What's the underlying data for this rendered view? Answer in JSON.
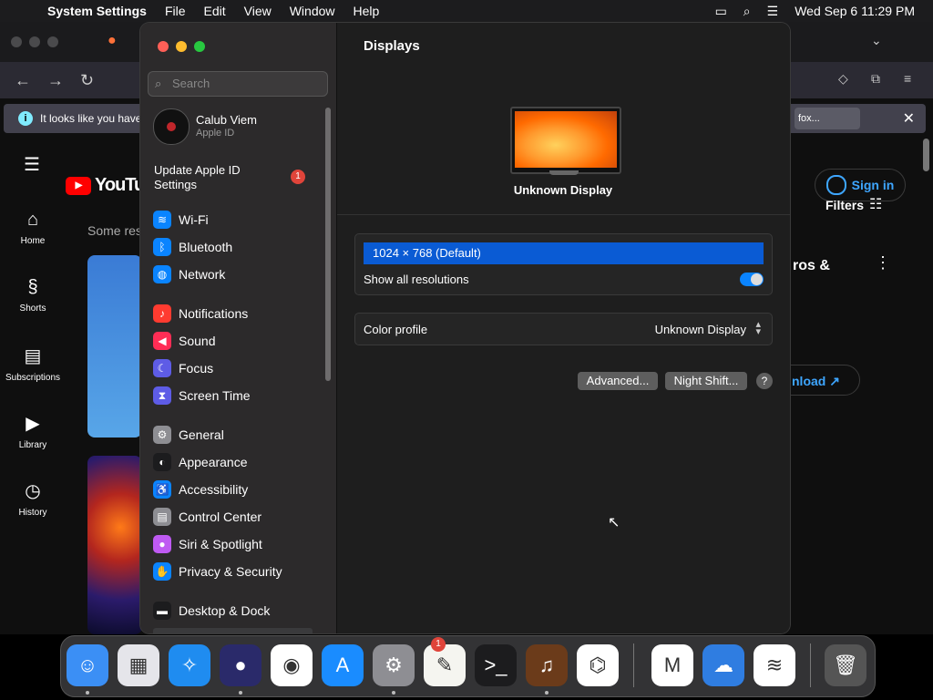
{
  "menubar": {
    "app": "System Settings",
    "menus": [
      "File",
      "Edit",
      "View",
      "Window",
      "Help"
    ],
    "datetime": "Wed Sep 6  11:29 PM"
  },
  "browser": {
    "info_text": "It looks like you have",
    "info_button": "fox...",
    "youtube": {
      "logo": "YouTube",
      "sidebar": [
        "Home",
        "Shorts",
        "Subscriptions",
        "Library",
        "History"
      ],
      "some_results": "Some res",
      "sign_in": "Sign in",
      "filters": "Filters",
      "partial_title": "ros &",
      "download": "nload"
    }
  },
  "settings": {
    "search_placeholder": "Search",
    "profile": {
      "name": "Calub Viem",
      "subtitle": "Apple ID"
    },
    "update": {
      "label_line1": "Update Apple ID",
      "label_line2": "Settings",
      "badge": "1"
    },
    "sidebar_groups": [
      [
        {
          "label": "Wi-Fi",
          "icon": "wifi-icon",
          "color": "#0a84ff"
        },
        {
          "label": "Bluetooth",
          "icon": "bluetooth-icon",
          "color": "#0a84ff"
        },
        {
          "label": "Network",
          "icon": "globe-icon",
          "color": "#0a84ff"
        }
      ],
      [
        {
          "label": "Notifications",
          "icon": "bell-icon",
          "color": "#ff3b30"
        },
        {
          "label": "Sound",
          "icon": "speaker-icon",
          "color": "#ff2d55"
        },
        {
          "label": "Focus",
          "icon": "moon-icon",
          "color": "#5e5ce6"
        },
        {
          "label": "Screen Time",
          "icon": "hourglass-icon",
          "color": "#5e5ce6"
        }
      ],
      [
        {
          "label": "General",
          "icon": "gear-icon",
          "color": "#8e8e93"
        },
        {
          "label": "Appearance",
          "icon": "appearance-icon",
          "color": "#1c1c1e"
        },
        {
          "label": "Accessibility",
          "icon": "accessibility-icon",
          "color": "#0a84ff"
        },
        {
          "label": "Control Center",
          "icon": "control-center-icon",
          "color": "#8e8e93"
        },
        {
          "label": "Siri & Spotlight",
          "icon": "siri-icon",
          "color": "#bf5af2"
        },
        {
          "label": "Privacy & Security",
          "icon": "hand-icon",
          "color": "#0a84ff"
        }
      ],
      [
        {
          "label": "Desktop & Dock",
          "icon": "dock-icon",
          "color": "#1c1c1e"
        }
      ]
    ],
    "main": {
      "title": "Displays",
      "display_name": "Unknown Display",
      "resolution": "1024 × 768 (Default)",
      "show_all_resolutions": "Show all resolutions",
      "show_all_resolutions_on": true,
      "color_profile_label": "Color profile",
      "color_profile_value": "Unknown Display",
      "advanced_button": "Advanced...",
      "night_shift_button": "Night Shift...",
      "help_button": "?"
    }
  },
  "dock": {
    "apps": [
      "Finder",
      "Launchpad",
      "Safari",
      "Firefox",
      "Chrome",
      "App Store",
      "System Settings",
      "TextEdit",
      "Terminal",
      "GarageBand",
      "VS Code",
      "Visual Studio",
      "Weather",
      "Wireless Diagnostics",
      "Trash"
    ],
    "settings_badge": "1"
  }
}
